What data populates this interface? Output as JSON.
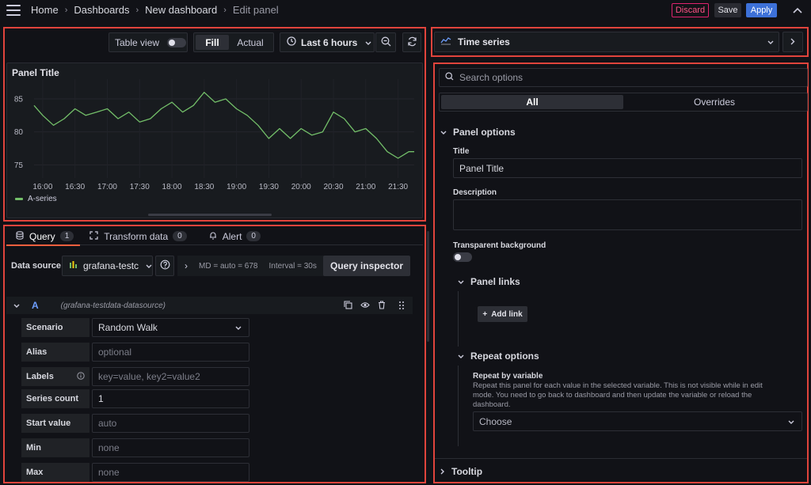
{
  "breadcrumbs": [
    "Home",
    "Dashboards",
    "New dashboard",
    "Edit panel"
  ],
  "actions": {
    "discard": "Discard",
    "save": "Save",
    "apply": "Apply"
  },
  "panel_toolbar": {
    "table_view": "Table view",
    "fill": "Fill",
    "actual": "Actual",
    "time_range": "Last 6 hours"
  },
  "panel": {
    "title": "Panel Title",
    "legend": "A-series"
  },
  "chart_data": {
    "type": "line",
    "title": "Panel Title",
    "x_ticks": [
      "16:00",
      "16:30",
      "17:00",
      "17:30",
      "18:00",
      "18:30",
      "19:00",
      "19:30",
      "20:00",
      "20:30",
      "21:00",
      "21:30"
    ],
    "y_ticks": [
      85,
      80,
      75
    ],
    "ylim": [
      73,
      88
    ],
    "series": [
      {
        "name": "A-series",
        "color": "#73bf69",
        "x": [
          "15:52",
          "16:00",
          "16:10",
          "16:20",
          "16:30",
          "16:40",
          "16:50",
          "17:00",
          "17:10",
          "17:20",
          "17:30",
          "17:40",
          "17:50",
          "18:00",
          "18:10",
          "18:20",
          "18:30",
          "18:40",
          "18:50",
          "19:00",
          "19:10",
          "19:20",
          "19:30",
          "19:40",
          "19:50",
          "20:00",
          "20:10",
          "20:20",
          "20:30",
          "20:40",
          "20:50",
          "21:00",
          "21:10",
          "21:20",
          "21:30",
          "21:40",
          "21:45"
        ],
        "values": [
          84.0,
          82.5,
          81.0,
          82.0,
          83.5,
          82.5,
          83.0,
          83.5,
          82.0,
          83.0,
          81.5,
          82.0,
          83.5,
          84.5,
          83.0,
          84.0,
          86.0,
          84.5,
          85.0,
          83.5,
          82.5,
          81.0,
          79.0,
          80.5,
          79.0,
          80.5,
          79.5,
          80.0,
          83.0,
          82.0,
          80.0,
          80.5,
          79.0,
          77.0,
          76.0,
          77.0,
          77.0
        ]
      }
    ]
  },
  "query_tabs": [
    {
      "label": "Query",
      "count": "1"
    },
    {
      "label": "Transform data",
      "count": "0"
    },
    {
      "label": "Alert",
      "count": "0"
    }
  ],
  "datasource": {
    "label": "Data source",
    "value": "grafana-testc",
    "md": "MD = auto = 678",
    "interval": "Interval = 30s",
    "inspector": "Query inspector"
  },
  "query": {
    "ref": "A",
    "source": "(grafana-testdata-datasource)",
    "fields": [
      {
        "label": "Scenario",
        "value": "Random Walk",
        "placeholder": false
      },
      {
        "label": "Alias",
        "value": "optional",
        "placeholder": true
      },
      {
        "label": "Labels",
        "value": "key=value, key2=value2",
        "placeholder": true
      },
      {
        "label": "Series count",
        "value": "1",
        "placeholder": false
      },
      {
        "label": "Start value",
        "value": "auto",
        "placeholder": true
      },
      {
        "label": "Min",
        "value": "none",
        "placeholder": true
      },
      {
        "label": "Max",
        "value": "none",
        "placeholder": true
      }
    ]
  },
  "viz": {
    "name": "Time series"
  },
  "options": {
    "search_placeholder": "Search options",
    "tabs": [
      "All",
      "Overrides"
    ],
    "panel_options": "Panel options",
    "title_label": "Title",
    "title_value": "Panel Title",
    "description_label": "Description",
    "transparent_label": "Transparent background",
    "panel_links": "Panel links",
    "add_link": "Add link",
    "repeat_options": "Repeat options",
    "repeat_by_label": "Repeat by variable",
    "repeat_help": "Repeat this panel for each value in the selected variable. This is not visible while in edit mode. You need to go back to dashboard and then update the variable or reload the dashboard.",
    "choose": "Choose",
    "tooltip": "Tooltip"
  }
}
